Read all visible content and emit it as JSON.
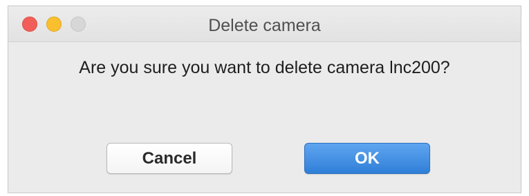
{
  "window": {
    "title": "Delete camera",
    "controls": [
      "close-icon",
      "minimize-icon",
      "zoom-icon"
    ]
  },
  "dialog": {
    "message": "Are you sure you want to delete camera lnc200?"
  },
  "buttons": {
    "cancel_label": "Cancel",
    "ok_label": "OK"
  },
  "colors": {
    "close": "#f25f58",
    "minimize": "#f9bf2f",
    "zoom_disabled": "#d7d7d7",
    "primary_button": "#2f7fd8"
  }
}
